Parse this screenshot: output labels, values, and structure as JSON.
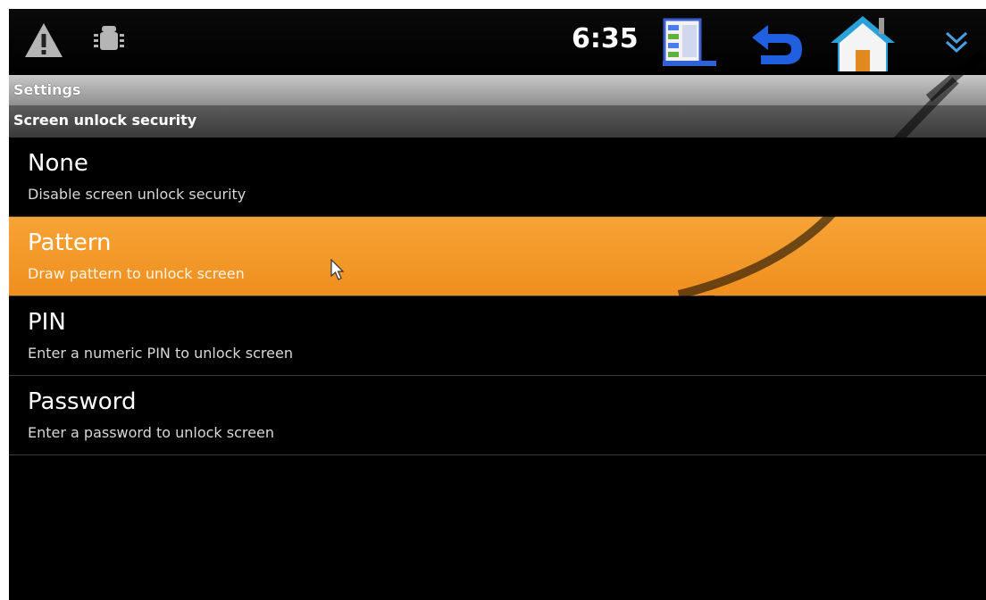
{
  "status_bar": {
    "time": "6:35",
    "icons_left": [
      "warning-icon",
      "android-debug-icon"
    ],
    "icons_right": [
      "recent-apps-icon",
      "back-icon",
      "home-icon",
      "expand-chevron-icon"
    ]
  },
  "header": {
    "title": "Settings"
  },
  "section": {
    "title": "Screen unlock security"
  },
  "options": [
    {
      "title": "None",
      "subtitle": "Disable screen unlock security"
    },
    {
      "title": "Pattern",
      "subtitle": "Draw pattern to unlock screen",
      "selected": true
    },
    {
      "title": "PIN",
      "subtitle": "Enter a numeric PIN to unlock screen"
    },
    {
      "title": "Password",
      "subtitle": "Enter a password to unlock screen"
    }
  ],
  "colors": {
    "accent": "#f39a2a",
    "background": "#000000"
  }
}
